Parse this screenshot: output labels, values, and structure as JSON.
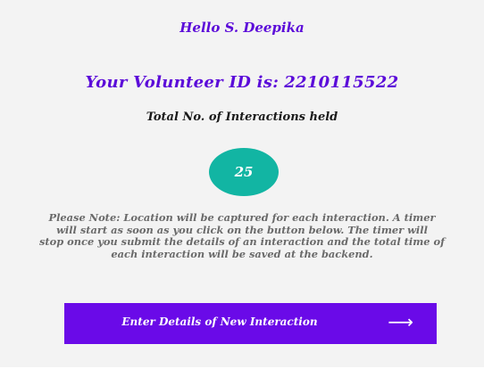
{
  "greeting": "Hello S. Deepika",
  "volunteer": {
    "label": "Your Volunteer ID is:",
    "id": "2210115522"
  },
  "interactions": {
    "title": "Total No.  of Interactions held",
    "count": "25"
  },
  "note": {
    "lines": [
      "Please Note: Location will be captured for each interaction.  A timer",
      "will start as soon as you click on the button below.  The timer will",
      "stop once you submit the details of an interaction and the total time of",
      "each interaction will be saved at the backend."
    ]
  },
  "primary_button": {
    "label": "Enter Details of  New Interaction",
    "icon": "arrow-right-icon"
  },
  "colors": {
    "accent": "#5b0bd9",
    "button": "#6a0ae8",
    "badge": "#12b5a3",
    "background": "#f3f3f3"
  }
}
